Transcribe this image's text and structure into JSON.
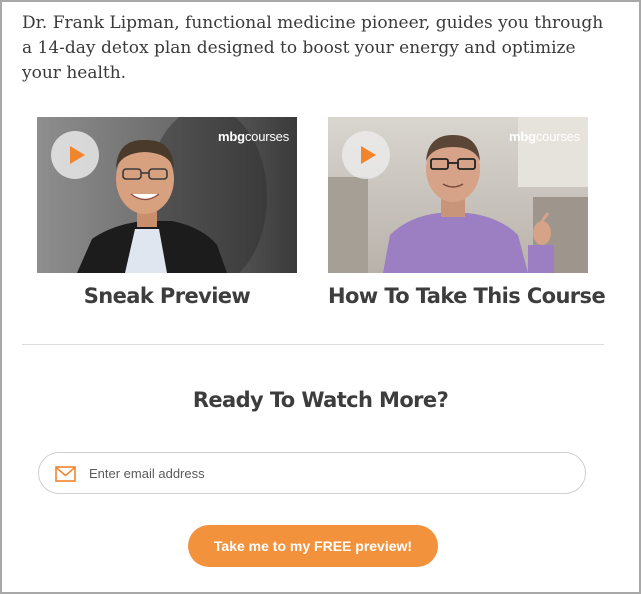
{
  "intro": {
    "text": "Dr. Frank Lipman, functional medicine pioneer, guides you through a 14-day detox plan designed to boost your energy and optimize your health."
  },
  "videos": [
    {
      "title": "Sneak Preview",
      "brand_bold": "mbg",
      "brand_rest": "courses",
      "icon": "play-icon"
    },
    {
      "title": "How To Take This Course",
      "brand_bold": "mbg",
      "brand_rest": "courses",
      "icon": "play-icon"
    }
  ],
  "cta": {
    "heading": "Ready To Watch More?",
    "email_placeholder": "Enter email address",
    "email_value": "",
    "email_icon": "envelope-icon",
    "button_label": "Take me to my FREE preview!"
  },
  "colors": {
    "accent": "#f3923c",
    "play_triangle": "#f0852d",
    "text": "#3d3d3d",
    "frame_border": "#a8a8a8"
  }
}
